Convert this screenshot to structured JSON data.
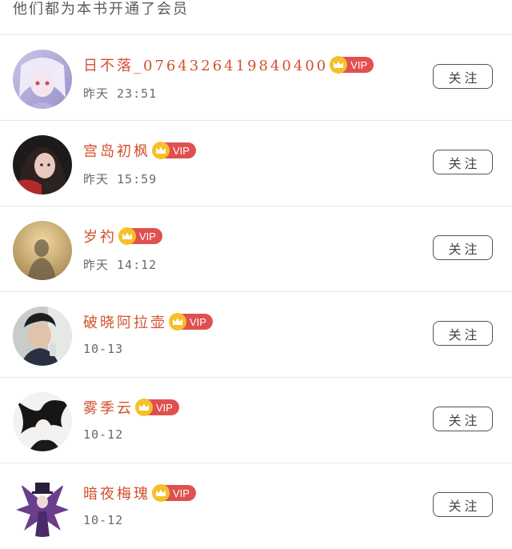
{
  "header": {
    "title": "他们都为本书开通了会员"
  },
  "follow_label": "关注",
  "vip_label": "VIP",
  "members": [
    {
      "name": "日不落_0764326419840400",
      "time": "昨天 23:51"
    },
    {
      "name": "宫岛初枫",
      "time": "昨天 15:59"
    },
    {
      "name": "岁礿",
      "time": "昨天 14:12"
    },
    {
      "name": "破晓阿拉壶",
      "time": "10-13"
    },
    {
      "name": "雾季云",
      "time": "10-12"
    },
    {
      "name": "暗夜梅瑰",
      "time": "10-12"
    }
  ],
  "colors": {
    "name": "#d2502f",
    "vip_badge": "#e05050",
    "crown": "#f5c02a",
    "divider": "#e6e6e6"
  },
  "icons": {
    "crown": "crown-icon"
  }
}
